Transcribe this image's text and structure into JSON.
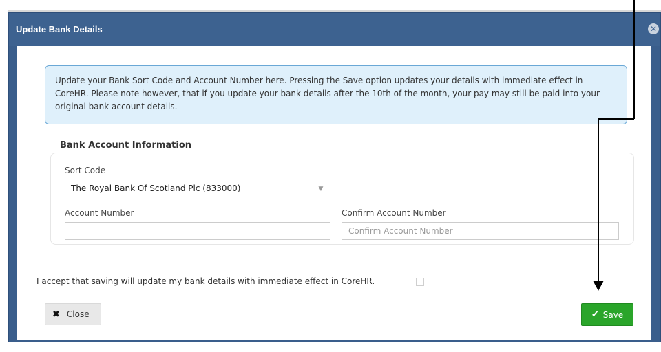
{
  "dialog": {
    "title": "Update Bank Details",
    "close_icon": "close-circle-icon"
  },
  "info": {
    "message": "Update your Bank Sort Code and Account Number here. Pressing the Save option updates your details with immediate effect in CoreHR. Please note however, that if you update your bank details after the 10th of the month, your pay may still be paid into your original bank account details."
  },
  "section": {
    "title": "Bank Account Information"
  },
  "form": {
    "sort_code_label": "Sort Code",
    "sort_code_value": "The Royal Bank Of Scotland Plc (833000)",
    "account_number_label": "Account Number",
    "account_number_value": "",
    "account_number_placeholder": "",
    "confirm_label": "Confirm Account Number",
    "confirm_value": "",
    "confirm_placeholder": "Confirm Account Number"
  },
  "acceptance": {
    "text": "I accept that saving will update my bank details with immediate effect in CoreHR.",
    "checked": false
  },
  "buttons": {
    "close_label": "Close",
    "close_icon": "x-icon",
    "save_label": "Save",
    "save_icon": "checkmark-icon"
  },
  "colors": {
    "header": "#3d6290",
    "save_green": "#2aa52a",
    "info_bg": "#dff0fb",
    "info_border": "#6aa8d6"
  }
}
